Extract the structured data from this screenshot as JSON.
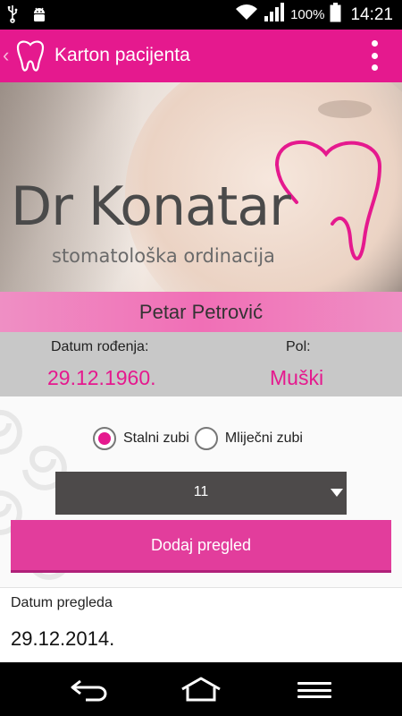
{
  "status_bar": {
    "battery_percent": "100%",
    "time": "14:21",
    "icons": [
      "usb-icon",
      "android-debug-icon",
      "wifi-icon",
      "signal-icon",
      "battery-icon"
    ]
  },
  "action_bar": {
    "title": "Karton pacijenta",
    "background_color": "#e5198e",
    "icons": [
      "back-chevron-icon",
      "tooth-logo-icon",
      "overflow-menu-icon"
    ]
  },
  "banner": {
    "brand_name": "Dr Konatar",
    "brand_subtitle": "stomatološka ordinacija",
    "icons": [
      "tooth-outline-logo"
    ]
  },
  "patient": {
    "name": "Petar Petrović",
    "birth_label": "Datum rođenja:",
    "birth_value": "29.12.1960.",
    "gender_label": "Pol:",
    "gender_value": "Muški"
  },
  "teeth_type": {
    "options": [
      {
        "label": "Stalni zubi",
        "checked": true
      },
      {
        "label": "Mliječni zubi",
        "checked": false
      }
    ]
  },
  "tooth_select": {
    "selected_value": "11"
  },
  "add_button": {
    "label": "Dodaj pregled",
    "color": "#e23d9c"
  },
  "review": {
    "label": "Datum pregleda",
    "date": "29.12.2014."
  },
  "nav_bar": {
    "icons": [
      "back-icon",
      "home-icon",
      "menu-icon"
    ]
  }
}
